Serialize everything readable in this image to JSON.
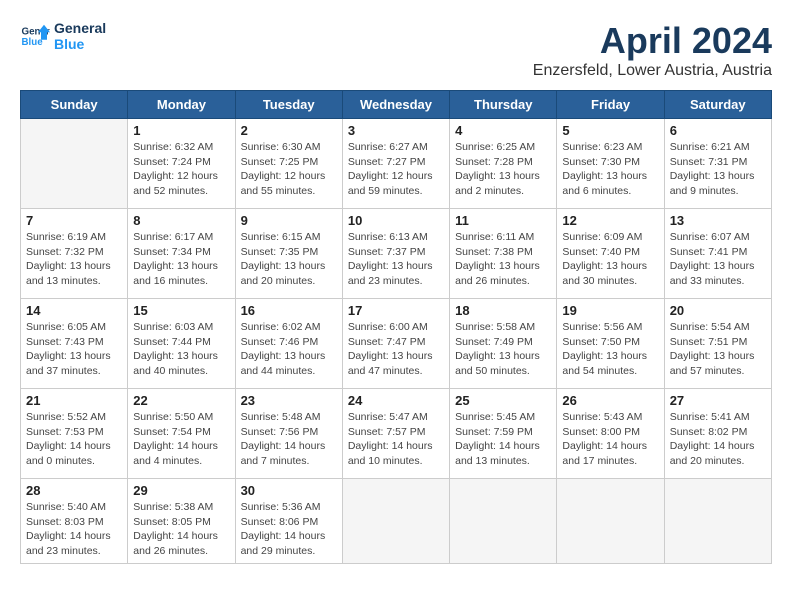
{
  "header": {
    "logo_line1": "General",
    "logo_line2": "Blue",
    "month": "April 2024",
    "location": "Enzersfeld, Lower Austria, Austria"
  },
  "weekdays": [
    "Sunday",
    "Monday",
    "Tuesday",
    "Wednesday",
    "Thursday",
    "Friday",
    "Saturday"
  ],
  "weeks": [
    [
      {
        "day": "",
        "info": ""
      },
      {
        "day": "1",
        "info": "Sunrise: 6:32 AM\nSunset: 7:24 PM\nDaylight: 12 hours\nand 52 minutes."
      },
      {
        "day": "2",
        "info": "Sunrise: 6:30 AM\nSunset: 7:25 PM\nDaylight: 12 hours\nand 55 minutes."
      },
      {
        "day": "3",
        "info": "Sunrise: 6:27 AM\nSunset: 7:27 PM\nDaylight: 12 hours\nand 59 minutes."
      },
      {
        "day": "4",
        "info": "Sunrise: 6:25 AM\nSunset: 7:28 PM\nDaylight: 13 hours\nand 2 minutes."
      },
      {
        "day": "5",
        "info": "Sunrise: 6:23 AM\nSunset: 7:30 PM\nDaylight: 13 hours\nand 6 minutes."
      },
      {
        "day": "6",
        "info": "Sunrise: 6:21 AM\nSunset: 7:31 PM\nDaylight: 13 hours\nand 9 minutes."
      }
    ],
    [
      {
        "day": "7",
        "info": "Sunrise: 6:19 AM\nSunset: 7:32 PM\nDaylight: 13 hours\nand 13 minutes."
      },
      {
        "day": "8",
        "info": "Sunrise: 6:17 AM\nSunset: 7:34 PM\nDaylight: 13 hours\nand 16 minutes."
      },
      {
        "day": "9",
        "info": "Sunrise: 6:15 AM\nSunset: 7:35 PM\nDaylight: 13 hours\nand 20 minutes."
      },
      {
        "day": "10",
        "info": "Sunrise: 6:13 AM\nSunset: 7:37 PM\nDaylight: 13 hours\nand 23 minutes."
      },
      {
        "day": "11",
        "info": "Sunrise: 6:11 AM\nSunset: 7:38 PM\nDaylight: 13 hours\nand 26 minutes."
      },
      {
        "day": "12",
        "info": "Sunrise: 6:09 AM\nSunset: 7:40 PM\nDaylight: 13 hours\nand 30 minutes."
      },
      {
        "day": "13",
        "info": "Sunrise: 6:07 AM\nSunset: 7:41 PM\nDaylight: 13 hours\nand 33 minutes."
      }
    ],
    [
      {
        "day": "14",
        "info": "Sunrise: 6:05 AM\nSunset: 7:43 PM\nDaylight: 13 hours\nand 37 minutes."
      },
      {
        "day": "15",
        "info": "Sunrise: 6:03 AM\nSunset: 7:44 PM\nDaylight: 13 hours\nand 40 minutes."
      },
      {
        "day": "16",
        "info": "Sunrise: 6:02 AM\nSunset: 7:46 PM\nDaylight: 13 hours\nand 44 minutes."
      },
      {
        "day": "17",
        "info": "Sunrise: 6:00 AM\nSunset: 7:47 PM\nDaylight: 13 hours\nand 47 minutes."
      },
      {
        "day": "18",
        "info": "Sunrise: 5:58 AM\nSunset: 7:49 PM\nDaylight: 13 hours\nand 50 minutes."
      },
      {
        "day": "19",
        "info": "Sunrise: 5:56 AM\nSunset: 7:50 PM\nDaylight: 13 hours\nand 54 minutes."
      },
      {
        "day": "20",
        "info": "Sunrise: 5:54 AM\nSunset: 7:51 PM\nDaylight: 13 hours\nand 57 minutes."
      }
    ],
    [
      {
        "day": "21",
        "info": "Sunrise: 5:52 AM\nSunset: 7:53 PM\nDaylight: 14 hours\nand 0 minutes."
      },
      {
        "day": "22",
        "info": "Sunrise: 5:50 AM\nSunset: 7:54 PM\nDaylight: 14 hours\nand 4 minutes."
      },
      {
        "day": "23",
        "info": "Sunrise: 5:48 AM\nSunset: 7:56 PM\nDaylight: 14 hours\nand 7 minutes."
      },
      {
        "day": "24",
        "info": "Sunrise: 5:47 AM\nSunset: 7:57 PM\nDaylight: 14 hours\nand 10 minutes."
      },
      {
        "day": "25",
        "info": "Sunrise: 5:45 AM\nSunset: 7:59 PM\nDaylight: 14 hours\nand 13 minutes."
      },
      {
        "day": "26",
        "info": "Sunrise: 5:43 AM\nSunset: 8:00 PM\nDaylight: 14 hours\nand 17 minutes."
      },
      {
        "day": "27",
        "info": "Sunrise: 5:41 AM\nSunset: 8:02 PM\nDaylight: 14 hours\nand 20 minutes."
      }
    ],
    [
      {
        "day": "28",
        "info": "Sunrise: 5:40 AM\nSunset: 8:03 PM\nDaylight: 14 hours\nand 23 minutes."
      },
      {
        "day": "29",
        "info": "Sunrise: 5:38 AM\nSunset: 8:05 PM\nDaylight: 14 hours\nand 26 minutes."
      },
      {
        "day": "30",
        "info": "Sunrise: 5:36 AM\nSunset: 8:06 PM\nDaylight: 14 hours\nand 29 minutes."
      },
      {
        "day": "",
        "info": ""
      },
      {
        "day": "",
        "info": ""
      },
      {
        "day": "",
        "info": ""
      },
      {
        "day": "",
        "info": ""
      }
    ]
  ]
}
